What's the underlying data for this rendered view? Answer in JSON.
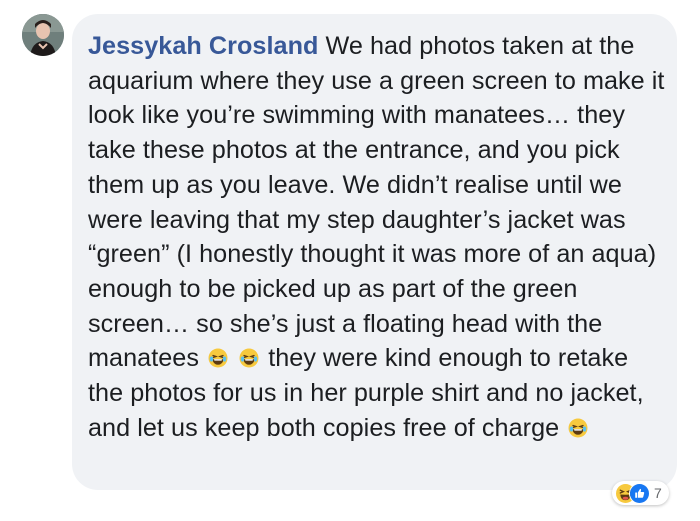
{
  "comment": {
    "author": "Jessykah Crosland",
    "segments": [
      " We had photos taken at the aquarium where they use a green screen to make it look like you’re swimming with manatees… they take these photos at the entrance, and you pick them up as you leave. We didn’t realise until we were leaving that my step daughter’s jacket was “green” (I honestly thought it was more of an aqua) enough to be picked up as part of the green screen… so she’s just a floating head with the manatees",
      " they were kind enough to retake the photos for us in her purple shirt and no jacket, and let us keep both copies free of charge"
    ],
    "emojis": [
      "laughing-emoji",
      "laughing-emoji",
      "laughing-emoji"
    ]
  },
  "reactions": {
    "icons": [
      "haha-reaction-icon",
      "like-reaction-icon"
    ],
    "count": "7"
  },
  "colors": {
    "author_link": "#385898",
    "bubble_background": "#f0f2f5",
    "text": "#1c1e21",
    "like_blue": "#1877f2",
    "haha_yellow": "#f7c93e"
  }
}
